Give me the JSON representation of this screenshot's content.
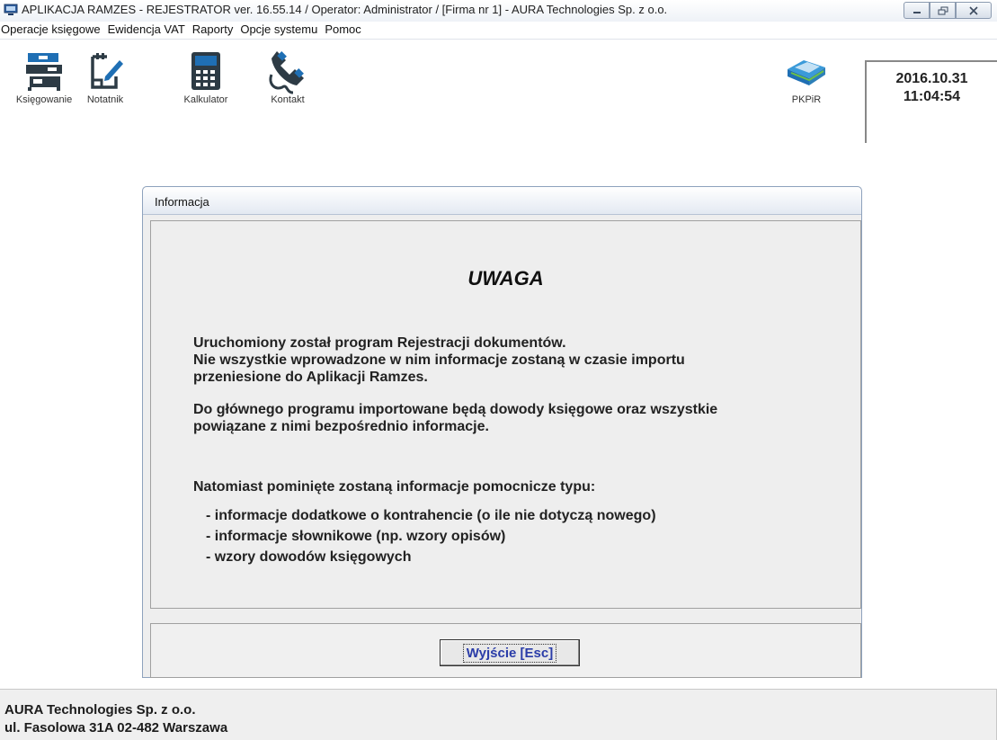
{
  "window": {
    "title": "APLIKACJA RAMZES - REJESTRATOR ver. 16.55.14 /  Operator: Administrator /  [Firma nr 1] - AURA Technologies Sp. z o.o."
  },
  "menu": {
    "items": [
      "Operacje księgowe",
      "Ewidencja VAT",
      "Raporty",
      "Opcje systemu",
      "Pomoc"
    ]
  },
  "toolbar": {
    "tools": [
      {
        "label": "Księgowanie",
        "icon": "ledger-binders-icon"
      },
      {
        "label": "Notatnik",
        "icon": "notepad-icon"
      },
      {
        "label": "Kalkulator",
        "icon": "calculator-icon"
      },
      {
        "label": "Kontakt",
        "icon": "phone-handset-icon"
      },
      {
        "label": "PKPiR",
        "icon": "book-icon"
      }
    ],
    "clock": {
      "date": "2016.10.31",
      "time": "11:04:54"
    }
  },
  "dialog": {
    "title": "Informacja",
    "heading": "UWAGA",
    "paragraph1": [
      "Uruchomiony został program Rejestracji dokumentów.",
      "Nie wszystkie wprowadzone w nim informacje zostaną w czasie importu",
      "przeniesione do Aplikacji Ramzes."
    ],
    "paragraph2": [
      "Do głównego programu importowane będą dowody księgowe oraz wszystkie",
      "powiązane z nimi bezpośrednio informacje."
    ],
    "paragraph3": "Natomiast pominięte zostaną informacje pomocnicze typu:",
    "bullets": [
      "- informacje dodatkowe o kontrahencie (o ile nie dotyczą nowego)",
      "- informacje słownikowe (np. wzory opisów)",
      "- wzory dowodów księgowych"
    ],
    "exit_button": "Wyjście  [Esc]"
  },
  "footer": {
    "company": "AURA Technologies Sp. z o.o.",
    "address": "ul. Fasolowa 31A  02-482 Warszawa"
  },
  "colors": {
    "button_text": "#2a3ca8",
    "dialog_border": "#8ea2bd",
    "icon_blue": "#1f6fb4",
    "icon_dark": "#2d3b45"
  }
}
